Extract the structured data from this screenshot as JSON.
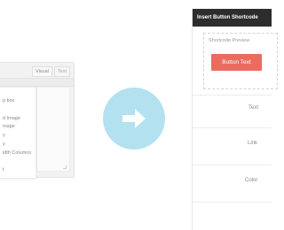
{
  "editor": {
    "tabs": [
      {
        "label": "Visual",
        "active": true
      },
      {
        "label": "Text",
        "active": false
      }
    ],
    "menu_items": [
      "p box",
      "",
      "d Image",
      "mage",
      "y",
      "y",
      "idth Columns",
      "",
      "t"
    ]
  },
  "arrow": {
    "icon": "arrow-right-icon",
    "circle_color": "#b3e1ef"
  },
  "panel": {
    "title": "Insert Button Shortcode",
    "preview_label": "Shortcode Preview",
    "button_text": "Button Text",
    "button_color": "#ec6b5f",
    "fields": [
      {
        "label": "Text"
      },
      {
        "label": "Link"
      },
      {
        "label": "Color"
      }
    ]
  }
}
